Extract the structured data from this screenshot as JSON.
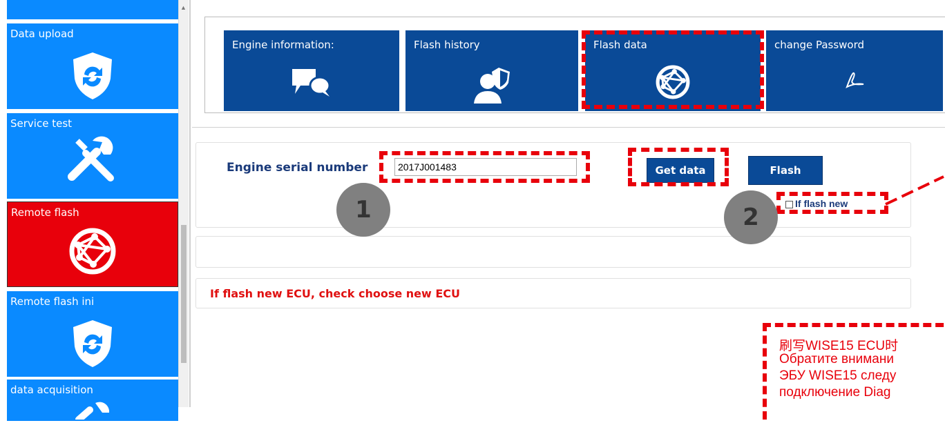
{
  "sidebar": {
    "items": [
      {
        "label": "Data upload",
        "icon": "shield-refresh-icon"
      },
      {
        "label": "Service test",
        "icon": "tools-icon"
      },
      {
        "label": "Remote flash",
        "icon": "globe-network-icon",
        "active": true
      },
      {
        "label": "Remote flash ini",
        "icon": "shield-refresh-icon"
      },
      {
        "label": "data acquisition",
        "icon": "tools-icon"
      }
    ]
  },
  "menu": {
    "tiles": [
      {
        "label": "Engine information:",
        "icon": "chat-bubbles-icon"
      },
      {
        "label": "Flash history",
        "icon": "user-shield-icon"
      },
      {
        "label": "Flash data",
        "icon": "globe-network-icon"
      },
      {
        "label": "change Password",
        "icon": "pdf-icon"
      }
    ]
  },
  "form": {
    "serial_label": "Engine serial number",
    "serial_value": "2017J001483",
    "get_data_label": "Get data",
    "flash_label": "Flash",
    "if_flash_new_label": "If flash new",
    "warning": "If flash new ECU, check choose new ECU"
  },
  "annotations": {
    "step1": "1",
    "step2": "2",
    "note_lines": [
      "刷写WISE15 ECU时",
      "Обратите внимани",
      "ЭБУ WISE15 следу",
      "подключение Diag"
    ]
  },
  "colors": {
    "tile_blue": "#0a8aff",
    "tile_active_red": "#e8000b",
    "menu_navy": "#0a4a97",
    "annotation_red": "#e8000b"
  }
}
